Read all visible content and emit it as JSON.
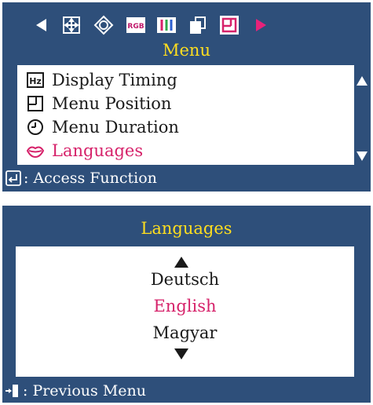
{
  "menu_panel": {
    "title": "Menu",
    "icon_bar": [
      {
        "icon": "arrow-left-icon"
      },
      {
        "icon": "position-move-icon"
      },
      {
        "icon": "geometry-icon"
      },
      {
        "icon": "rgb-icon",
        "text": "RGB"
      },
      {
        "icon": "color-balance-icon"
      },
      {
        "icon": "copy-windows-icon"
      },
      {
        "icon": "menu-setup-icon",
        "selected": true
      },
      {
        "icon": "arrow-right-icon"
      }
    ],
    "items": [
      {
        "icon": "hz-icon",
        "icon_text": "Hz",
        "label": "Display Timing",
        "selected": false
      },
      {
        "icon": "menu-position-icon",
        "label": "Menu Position",
        "selected": false
      },
      {
        "icon": "clock-icon",
        "label": "Menu Duration",
        "selected": false
      },
      {
        "icon": "lips-icon",
        "label": "Languages",
        "selected": true
      }
    ],
    "footer": {
      "icon": "enter-key-icon",
      "text": ": Access Function"
    }
  },
  "languages_panel": {
    "title": "Languages",
    "items": [
      {
        "label": "Deutsch",
        "selected": false
      },
      {
        "label": "English",
        "selected": true
      },
      {
        "label": "Magyar",
        "selected": false
      }
    ],
    "footer": {
      "icon": "exit-door-icon",
      "text": ": Previous Menu"
    }
  },
  "colors": {
    "panel_background": "#2e4f7a",
    "title_yellow": "#ffde1f",
    "highlight_pink": "#d6226a",
    "list_background": "#ffffff"
  }
}
